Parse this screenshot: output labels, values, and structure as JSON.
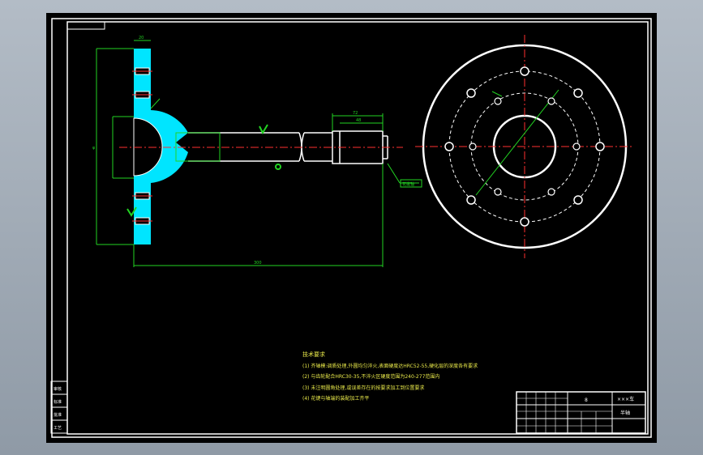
{
  "drawing": {
    "colors": {
      "background": "#000000",
      "frame": "#ffffff",
      "part_fill": "#00e5ff",
      "dimension": "#22d322",
      "centerline": "#ff3030",
      "notes": "#e9e94a"
    },
    "notes": {
      "title": "技术要求",
      "lines": [
        "(1) 齐轴模:调质处理,外圆均匀淬火,表面硬度达HRC52-55,硬化层的深度各有要求",
        "(2) 与齿轮配合HRC30-35,不淬火区硬度范围为240-277范围内",
        "(3) 未注明圆角处理,或误差存在的按要求加工到位置要求",
        "(4) 花键与轴端的装配加工齐平"
      ]
    },
    "title_block": {
      "part_name": "半轴",
      "drawing_no": "×××车",
      "mark": "8"
    },
    "side_box": {
      "lines": [
        "审核",
        "标准",
        "批准",
        "工艺"
      ]
    },
    "dimensions": {
      "shaft_length": "300",
      "flange_height": "φ",
      "flange_thickness": "20",
      "spline_length": "72",
      "spline_inner": "48"
    },
    "callout": "花键轴"
  }
}
